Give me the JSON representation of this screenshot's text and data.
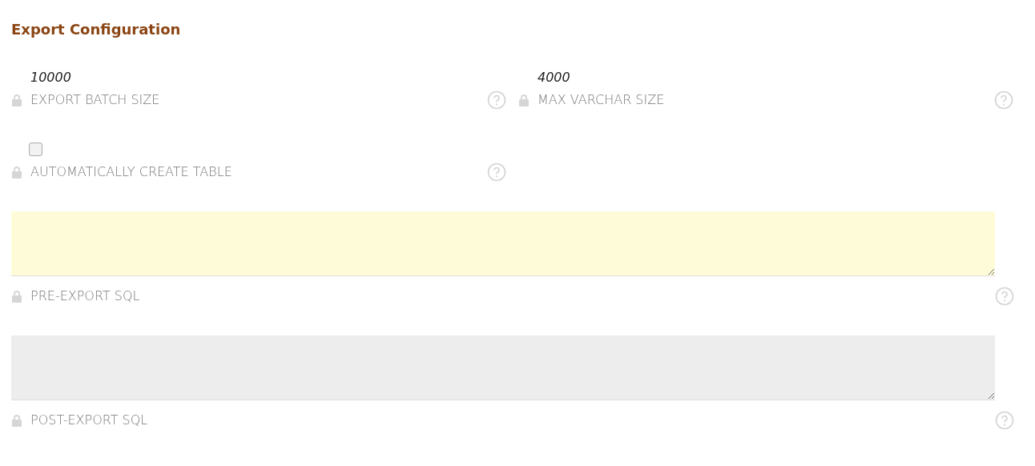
{
  "section": {
    "title": "Export Configuration"
  },
  "fields": [
    {
      "kind": "text",
      "value": "10000",
      "label": "EXPORT BATCH SIZE"
    },
    {
      "kind": "text",
      "value": "4000",
      "label": "MAX VARCHAR SIZE"
    },
    {
      "kind": "checkbox",
      "checked": false,
      "label": "AUTOMATICALLY CREATE TABLE"
    },
    {
      "kind": "textarea",
      "color": "#fefcd8",
      "label": "PRE-EXPORT SQL"
    },
    {
      "kind": "textarea",
      "color": "#ededed",
      "label": "POST-EXPORT SQL"
    }
  ]
}
